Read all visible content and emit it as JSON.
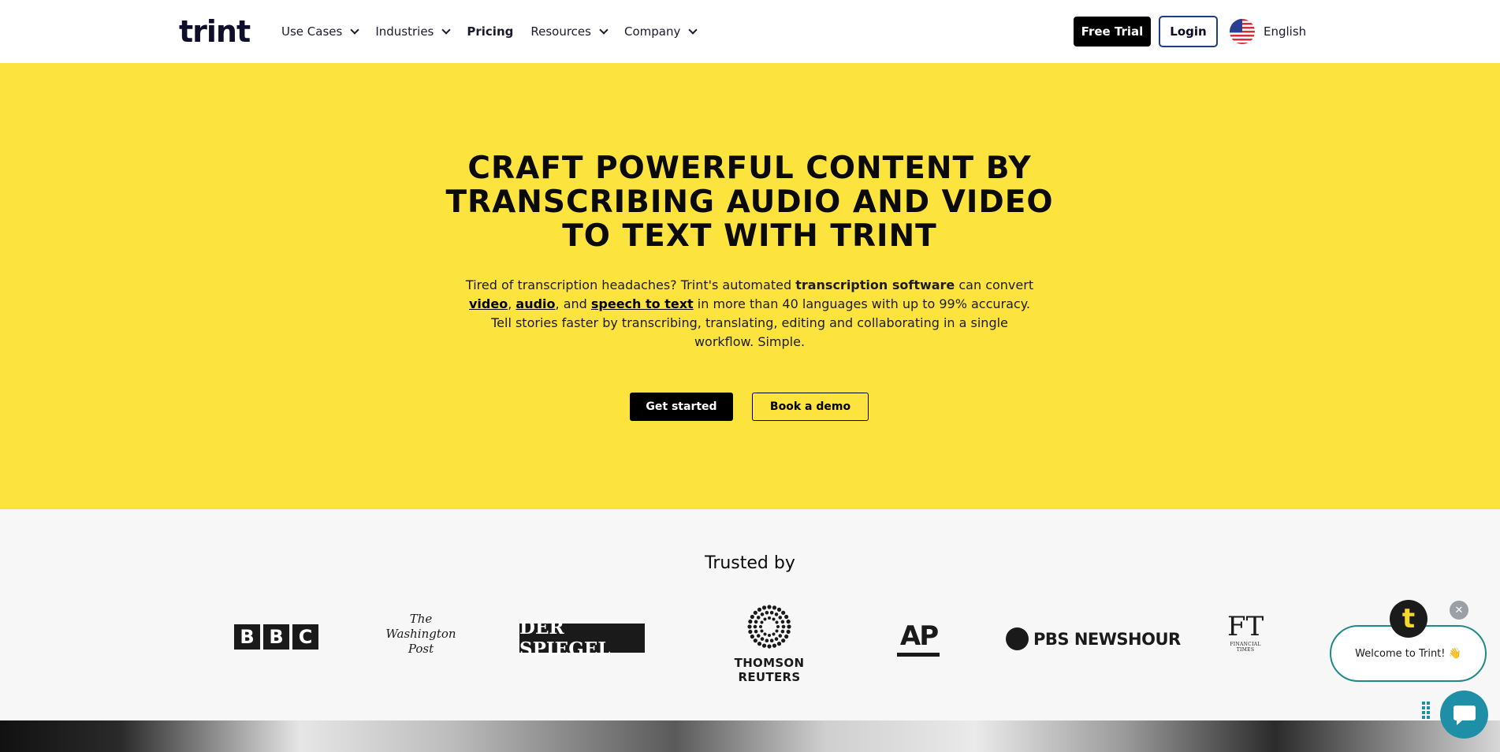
{
  "nav": {
    "logo": "trint",
    "items": [
      {
        "label": "Use Cases",
        "dropdown": true
      },
      {
        "label": "Industries",
        "dropdown": true
      },
      {
        "label": "Pricing",
        "dropdown": false
      },
      {
        "label": "Resources",
        "dropdown": true
      },
      {
        "label": "Company",
        "dropdown": true
      }
    ],
    "free_trial": "Free Trial",
    "login": "Login",
    "language": "English"
  },
  "hero": {
    "title": "CRAFT POWERFUL CONTENT BY TRANSCRIBING AUDIO AND VIDEO TO TEXT WITH TRINT",
    "body_1": "Tired of transcription headaches? Trint's automated ",
    "body_bold": "transcription software",
    "body_2": " can convert ",
    "link_video": "video",
    "sep_1": ", ",
    "link_audio": "audio",
    "sep_2": ", and ",
    "link_speech": "speech to text",
    "body_3": " in more than 40 languages with up to 99% accuracy. Tell stories faster by transcribing, translating, editing and collaborating in a single workflow. Simple.",
    "cta_primary": "Get started",
    "cta_secondary": "Book a demo"
  },
  "trusted": {
    "title": "Trusted by",
    "bbc": [
      "B",
      "B",
      "C"
    ],
    "wapo": [
      "The",
      "Washington",
      "Post"
    ],
    "spiegel": "DER SPIEGEL",
    "reuters": "THOMSON REUTERS",
    "ap": "AP",
    "pbs": "PBS NEWSHOUR",
    "ft": "FT",
    "ft_sub": [
      "FINANCIAL",
      "TIMES"
    ]
  },
  "chat": {
    "welcome": "Welcome to Trint! 👋",
    "avatar_letter": "t",
    "close": "✕"
  },
  "colors": {
    "hero_bg": "#fce33d",
    "trusted_bg": "#f7f7f7",
    "chat_accent": "#1f8fa8",
    "login_border": "#1f3b8a"
  }
}
